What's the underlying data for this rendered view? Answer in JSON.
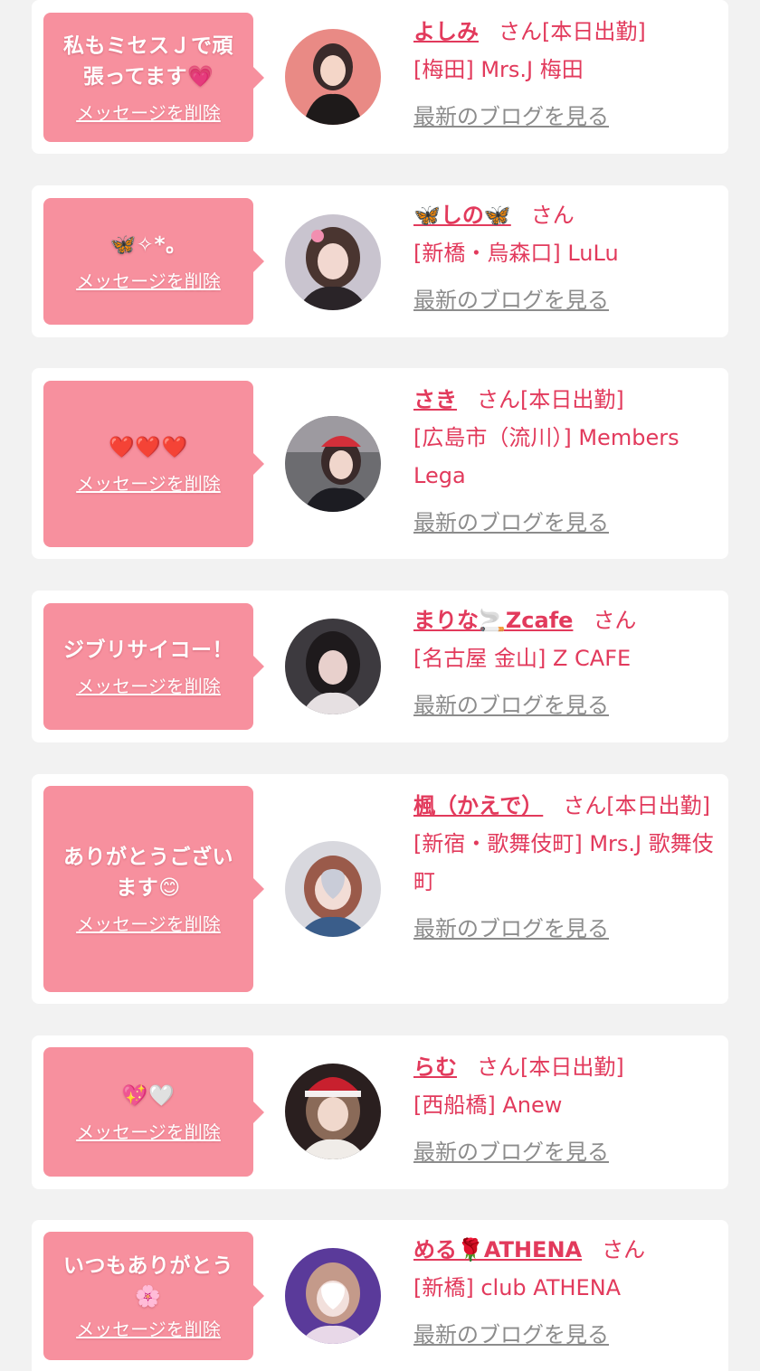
{
  "delete_label": "メッセージを削除",
  "blog_label": "最新のブログを見る",
  "honorific": "さん",
  "cards": [
    {
      "message": "私もミセスＪで頑張ってます💗",
      "name": "よしみ",
      "status": "[本日出勤]",
      "shop": "[梅田] Mrs.J 梅田"
    },
    {
      "message": "🦋✧*。",
      "name": "🦋しの🦋",
      "status": "",
      "shop": "[新橋・烏森口] LuLu"
    },
    {
      "message": "❤️❤️❤️",
      "name": "さき",
      "status": "[本日出勤]",
      "shop": "[広島市（流川）] Members Lega"
    },
    {
      "message": "ジブリサイコー！",
      "name": "まりな🚬Zcafe",
      "status": "",
      "shop": "[名古屋 金山] Z CAFE"
    },
    {
      "message": "ありがとうございます😊",
      "name": "楓（かえで）",
      "status": "[本日出勤]",
      "shop": "[新宿・歌舞伎町] Mrs.J 歌舞伎町"
    },
    {
      "message": "💖🤍",
      "name": "らむ",
      "status": "[本日出勤]",
      "shop": "[西船橋] Anew"
    },
    {
      "message": "いつもありがとう🌸",
      "name": "める🌹ATHENA",
      "status": "",
      "shop": "[新橋] club ATHENA"
    }
  ],
  "colors": {
    "accent": "#e23a5c",
    "bubble": "#f7909e",
    "link_gray": "#8c8c8c",
    "background": "#f2f2f2"
  }
}
